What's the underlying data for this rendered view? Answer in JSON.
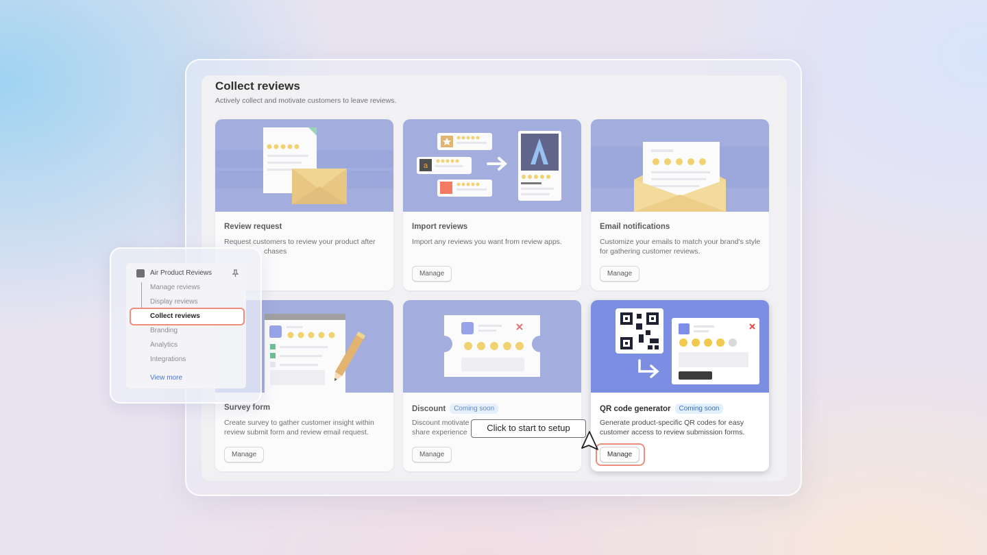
{
  "page": {
    "title": "Collect reviews",
    "subtitle": "Actively collect and motivate customers to leave reviews."
  },
  "cards": [
    {
      "title": "Review request",
      "desc": "Request customers to review your product after",
      "desc_line2": "chases",
      "button": ""
    },
    {
      "title": "Import reviews",
      "desc": "Import any reviews you want from review apps.",
      "button": "Manage"
    },
    {
      "title": "Email notifications",
      "desc": "Customize your emails to match your brand's style for gathering customer reviews.",
      "button": "Manage"
    },
    {
      "title": "Survey form",
      "desc": "Create survey to gather customer insight within review submit form and review email request.",
      "button": "Manage"
    },
    {
      "title": "Discount",
      "badge": "Coming soon",
      "desc": "Discount motivate",
      "desc_line2": "share experience",
      "button": "Manage"
    },
    {
      "title": "QR code generator",
      "badge": "Coming soon",
      "desc": "Generate product-specific QR codes for easy customer access to review submission forms.",
      "button": "Manage"
    }
  ],
  "sidebar": {
    "app_name": "Air Product Reviews",
    "items": [
      "Manage reviews",
      "Display reviews",
      "Collect reviews",
      "Branding",
      "Analytics",
      "Integrations"
    ],
    "active": "Collect reviews",
    "view_more": "View more"
  },
  "tooltip": {
    "text": "Click to start to setup"
  },
  "icons": {
    "card1": "document-envelope-icon",
    "card2": "import-arrow-icon",
    "card3": "email-stars-icon",
    "card4": "survey-pencil-icon",
    "card5": "coupon-icon",
    "card6": "qr-code-icon",
    "cursor": "pointer-cursor-icon",
    "pin": "pin-icon"
  },
  "colors": {
    "illustration_bg": "#8e9bd9",
    "star": "#f2c94c",
    "highlight": "#ef8c7c",
    "badge_bg": "#e3f0fc",
    "badge_text": "#3a6db8",
    "link": "#4b72c9"
  }
}
